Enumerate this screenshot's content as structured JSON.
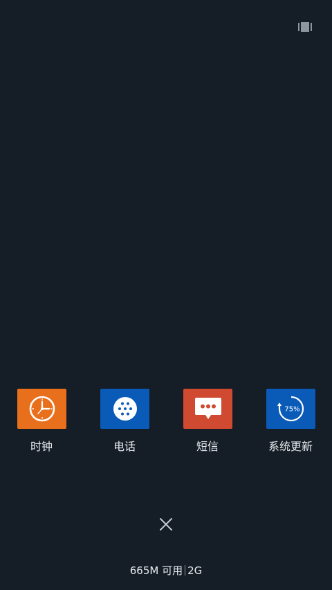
{
  "colors": {
    "background": "#151d26",
    "clock_tile": "#e8701c",
    "phone_tile": "#0a5bb8",
    "sms_tile": "#cf4a31",
    "update_tile": "#0a5bb8"
  },
  "top_icon": "layout-switch-icon",
  "apps": [
    {
      "label": "时钟",
      "icon": "clock-icon"
    },
    {
      "label": "电话",
      "icon": "dialpad-icon"
    },
    {
      "label": "短信",
      "icon": "chat-bubble-icon"
    },
    {
      "label": "系统更新",
      "icon": "update-progress-icon",
      "progress_text": "75%",
      "progress": 0.75
    }
  ],
  "close_icon": "close-icon",
  "status": {
    "memory": "665M 可用",
    "total": "2G"
  }
}
